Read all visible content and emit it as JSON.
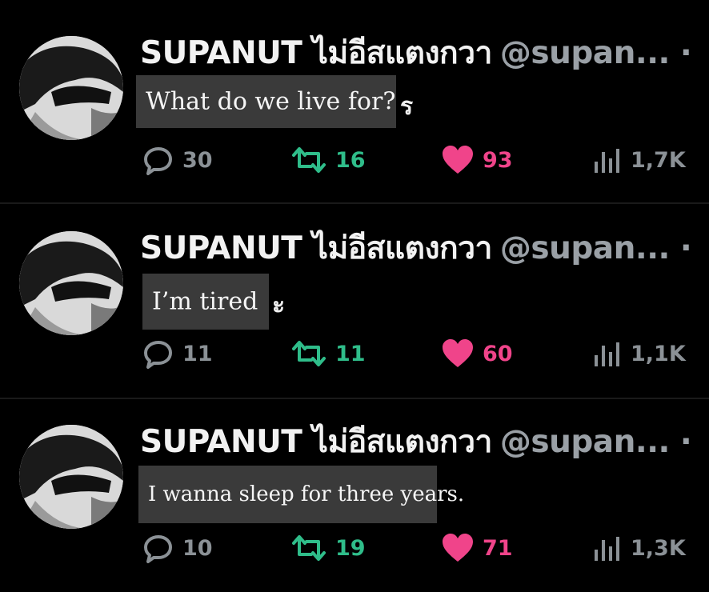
{
  "tweets": [
    {
      "display_name": "SUPANUT ไม่อีสแตงกวา",
      "handle": "@supan... ·",
      "text": "What do we live for?",
      "trailing_char": "ร",
      "replies": "30",
      "retweets": "16",
      "likes": "93",
      "views": "1,7K"
    },
    {
      "display_name": "SUPANUT ไม่อีสแตงกวา",
      "handle": "@supan... ·",
      "text": "I’m tired",
      "trailing_char": "ะ",
      "replies": "11",
      "retweets": "11",
      "likes": "60",
      "views": "1,1K"
    },
    {
      "display_name": "SUPANUT ไม่อีสแตงกวา",
      "handle": "@supan... ·",
      "text": "I wanna sleep for three years.",
      "trailing_char": "",
      "replies": "10",
      "retweets": "19",
      "likes": "71",
      "views": "1,3K"
    }
  ],
  "icons": {
    "reply": "reply-icon",
    "retweet": "retweet-icon",
    "like": "heart-icon",
    "views": "views-icon"
  },
  "colors": {
    "background": "#000000",
    "retweet": "#2fbd8a",
    "like": "#f0448a",
    "muted": "#8b9196",
    "textbox": "#3a3a3a"
  }
}
